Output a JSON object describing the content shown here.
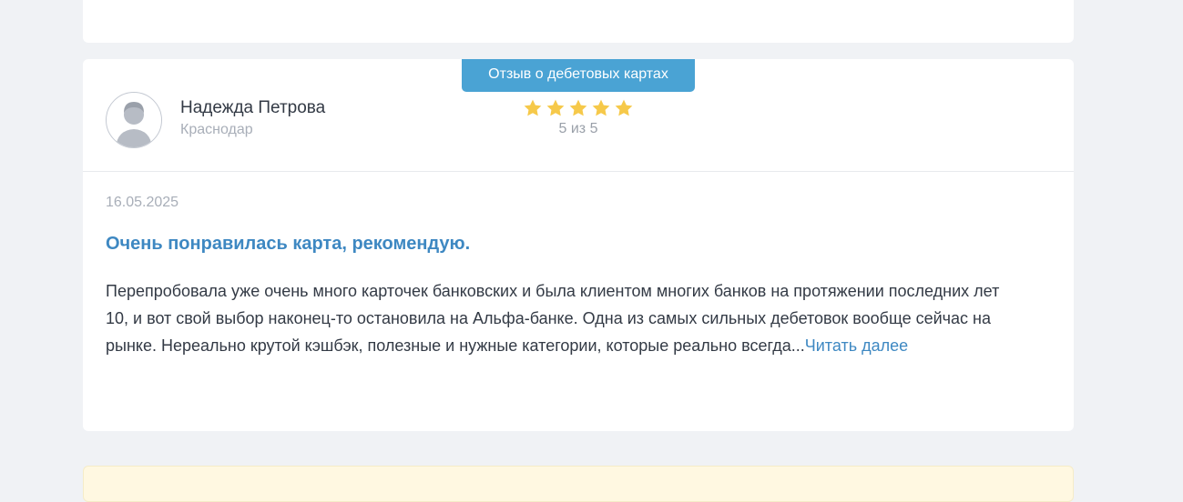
{
  "review": {
    "category": "Отзыв о дебетовых картах",
    "author": {
      "name": "Надежда Петрова",
      "city": "Краснодар"
    },
    "rating": {
      "value": 5,
      "max": 5,
      "text": "5 из 5"
    },
    "date": "16.05.2025",
    "title": "Очень понравилась карта, рекомендую.",
    "body": "Перепробовала уже очень много карточек банковских и была клиентом многих банков на протяжении последних лет 10, и вот свой выбор наконец-то остановила на Альфа-банке. Одна из самых сильных дебетовок вообще сейчас на рынке. Нереально крутой кэшбэк, полезные и нужные категории, которые реально всегда...",
    "read_more": "Читать далее"
  },
  "colors": {
    "badge": "#4aa3d4",
    "link": "#3e88c2",
    "star": "#f6c94a",
    "page_bg": "#f0f2f5"
  },
  "icons": {
    "avatar": "user-avatar-icon",
    "star": "star-icon"
  }
}
